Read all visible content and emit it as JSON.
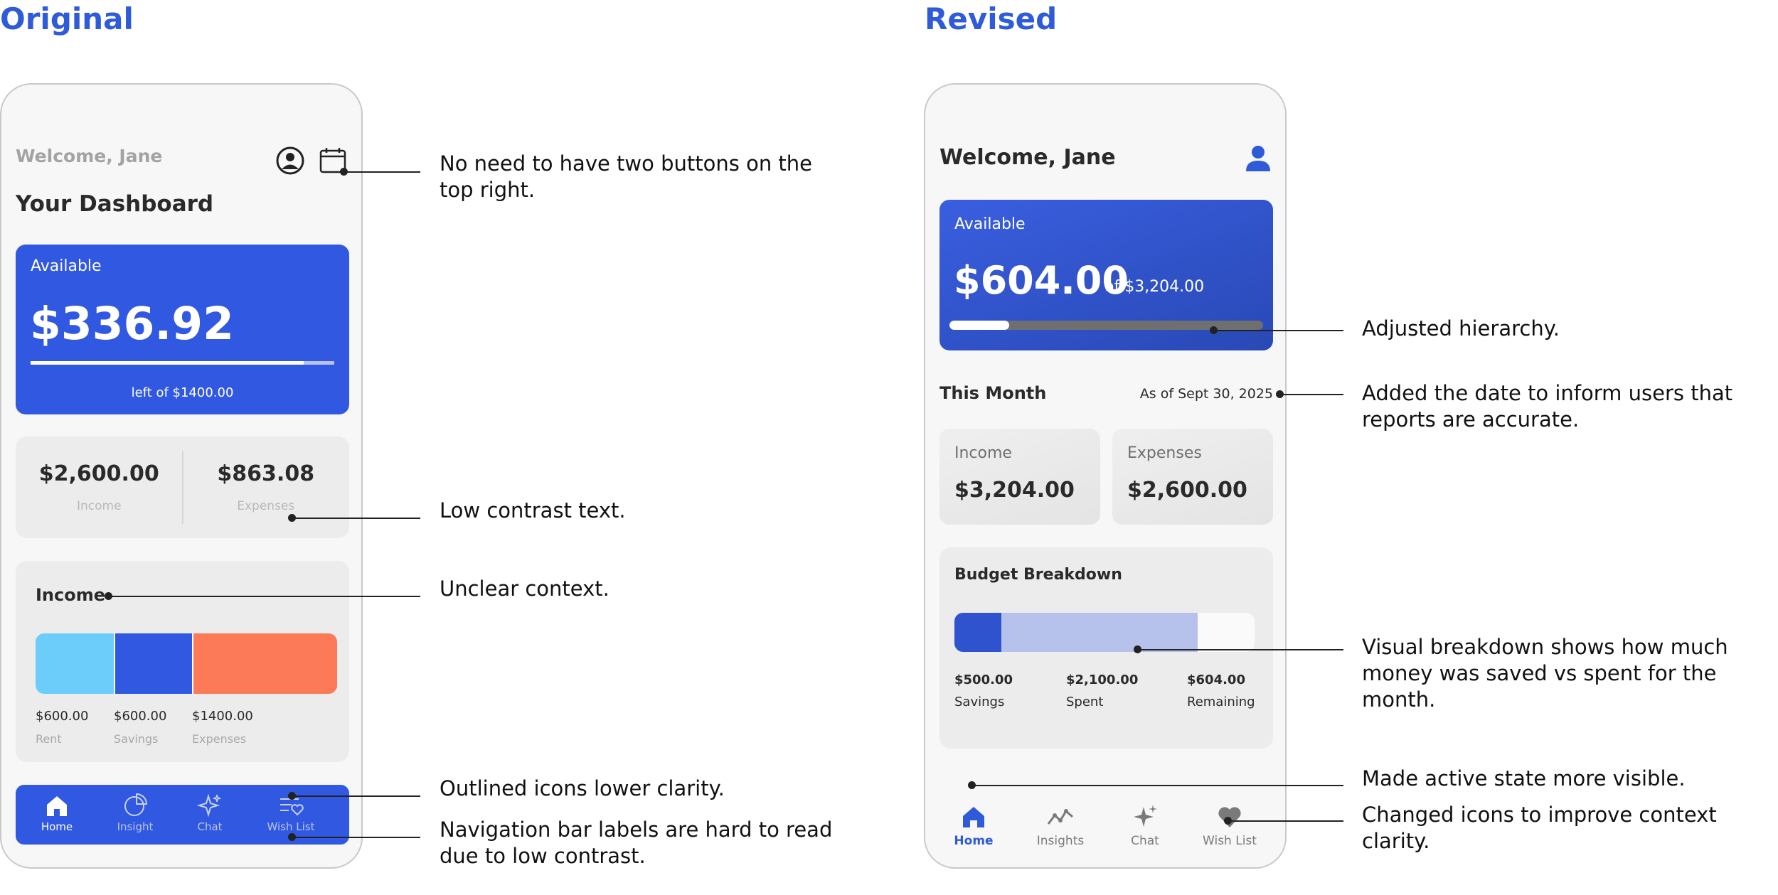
{
  "sections": {
    "original_title": "Original",
    "revised_title": "Revised"
  },
  "original": {
    "welcome": "Welcome, Jane",
    "dashboard_title": "Your Dashboard",
    "icons": [
      "profile-icon",
      "calendar-icon"
    ],
    "available": {
      "label": "Available",
      "amount": "$336.92",
      "left_text": "left of $1400.00",
      "progress": 0.9
    },
    "stats": {
      "income_value": "$2,600.00",
      "income_label": "Income",
      "expenses_value": "$863.08",
      "expenses_label": "Expenses"
    },
    "income_card": {
      "title": "Income",
      "segments": [
        {
          "value": "$600.00",
          "label": "Rent",
          "color": "#6ccdfb",
          "share": 0.26
        },
        {
          "value": "$600.00",
          "label": "Savings",
          "color": "#3158e0",
          "share": 0.26
        },
        {
          "value": "$1400.00",
          "label": "Expenses",
          "color": "#fd7a58",
          "share": 0.48
        }
      ]
    },
    "nav": [
      {
        "label": "Home",
        "icon": "home-icon"
      },
      {
        "label": "Insight",
        "icon": "pie-chart-icon"
      },
      {
        "label": "Chat",
        "icon": "sparkle-icon"
      },
      {
        "label": "Wish List",
        "icon": "wishlist-icon"
      }
    ]
  },
  "revised": {
    "welcome": "Welcome, Jane",
    "icons": [
      "profile-icon"
    ],
    "available": {
      "label": "Available",
      "amount": "$604.00",
      "of_text": "of $3,204.00",
      "progress": 0.19
    },
    "this_month": {
      "title": "This Month",
      "as_of": "As of Sept 30, 2025"
    },
    "income": {
      "label": "Income",
      "value": "$3,204.00"
    },
    "expenses": {
      "label": "Expenses",
      "value": "$2,600.00"
    },
    "budget": {
      "title": "Budget Breakdown",
      "segments": [
        {
          "value": "$500.00",
          "label": "Savings",
          "color": "#2f52cf",
          "share": 0.156
        },
        {
          "value": "$2,100.00",
          "label": "Spent",
          "color": "#b7c2ec",
          "share": 0.655
        },
        {
          "value": "$604.00",
          "label": "Remaining",
          "color": "#fafafa",
          "share": 0.189
        }
      ]
    },
    "nav": [
      {
        "label": "Home",
        "icon": "home-icon",
        "active": true
      },
      {
        "label": "Insights",
        "icon": "trend-line-icon",
        "active": false
      },
      {
        "label": "Chat",
        "icon": "sparkle-icon",
        "active": false
      },
      {
        "label": "Wish List",
        "icon": "heart-icon",
        "active": false
      }
    ]
  },
  "annotations": {
    "top_buttons": "No need to have two buttons on the\ntop right.",
    "low_contrast": "Low contrast text.",
    "unclear_context": "Unclear context.",
    "outlined_icons": "Outlined icons lower clarity.",
    "nav_labels": "Navigation bar labels are hard to read\ndue to low contrast.",
    "hierarchy": "Adjusted hierarchy.",
    "date_added": "Added the date to inform users that\nreports are accurate.",
    "visual_breakdown": "Visual breakdown shows how much\nmoney was saved vs spent for the month.",
    "active_state": "Made active state more visible.",
    "icons_changed": "Changed icons to improve context clarity."
  },
  "colors": {
    "accent": "#2f5bd9",
    "card_blue": "#3158e0"
  }
}
